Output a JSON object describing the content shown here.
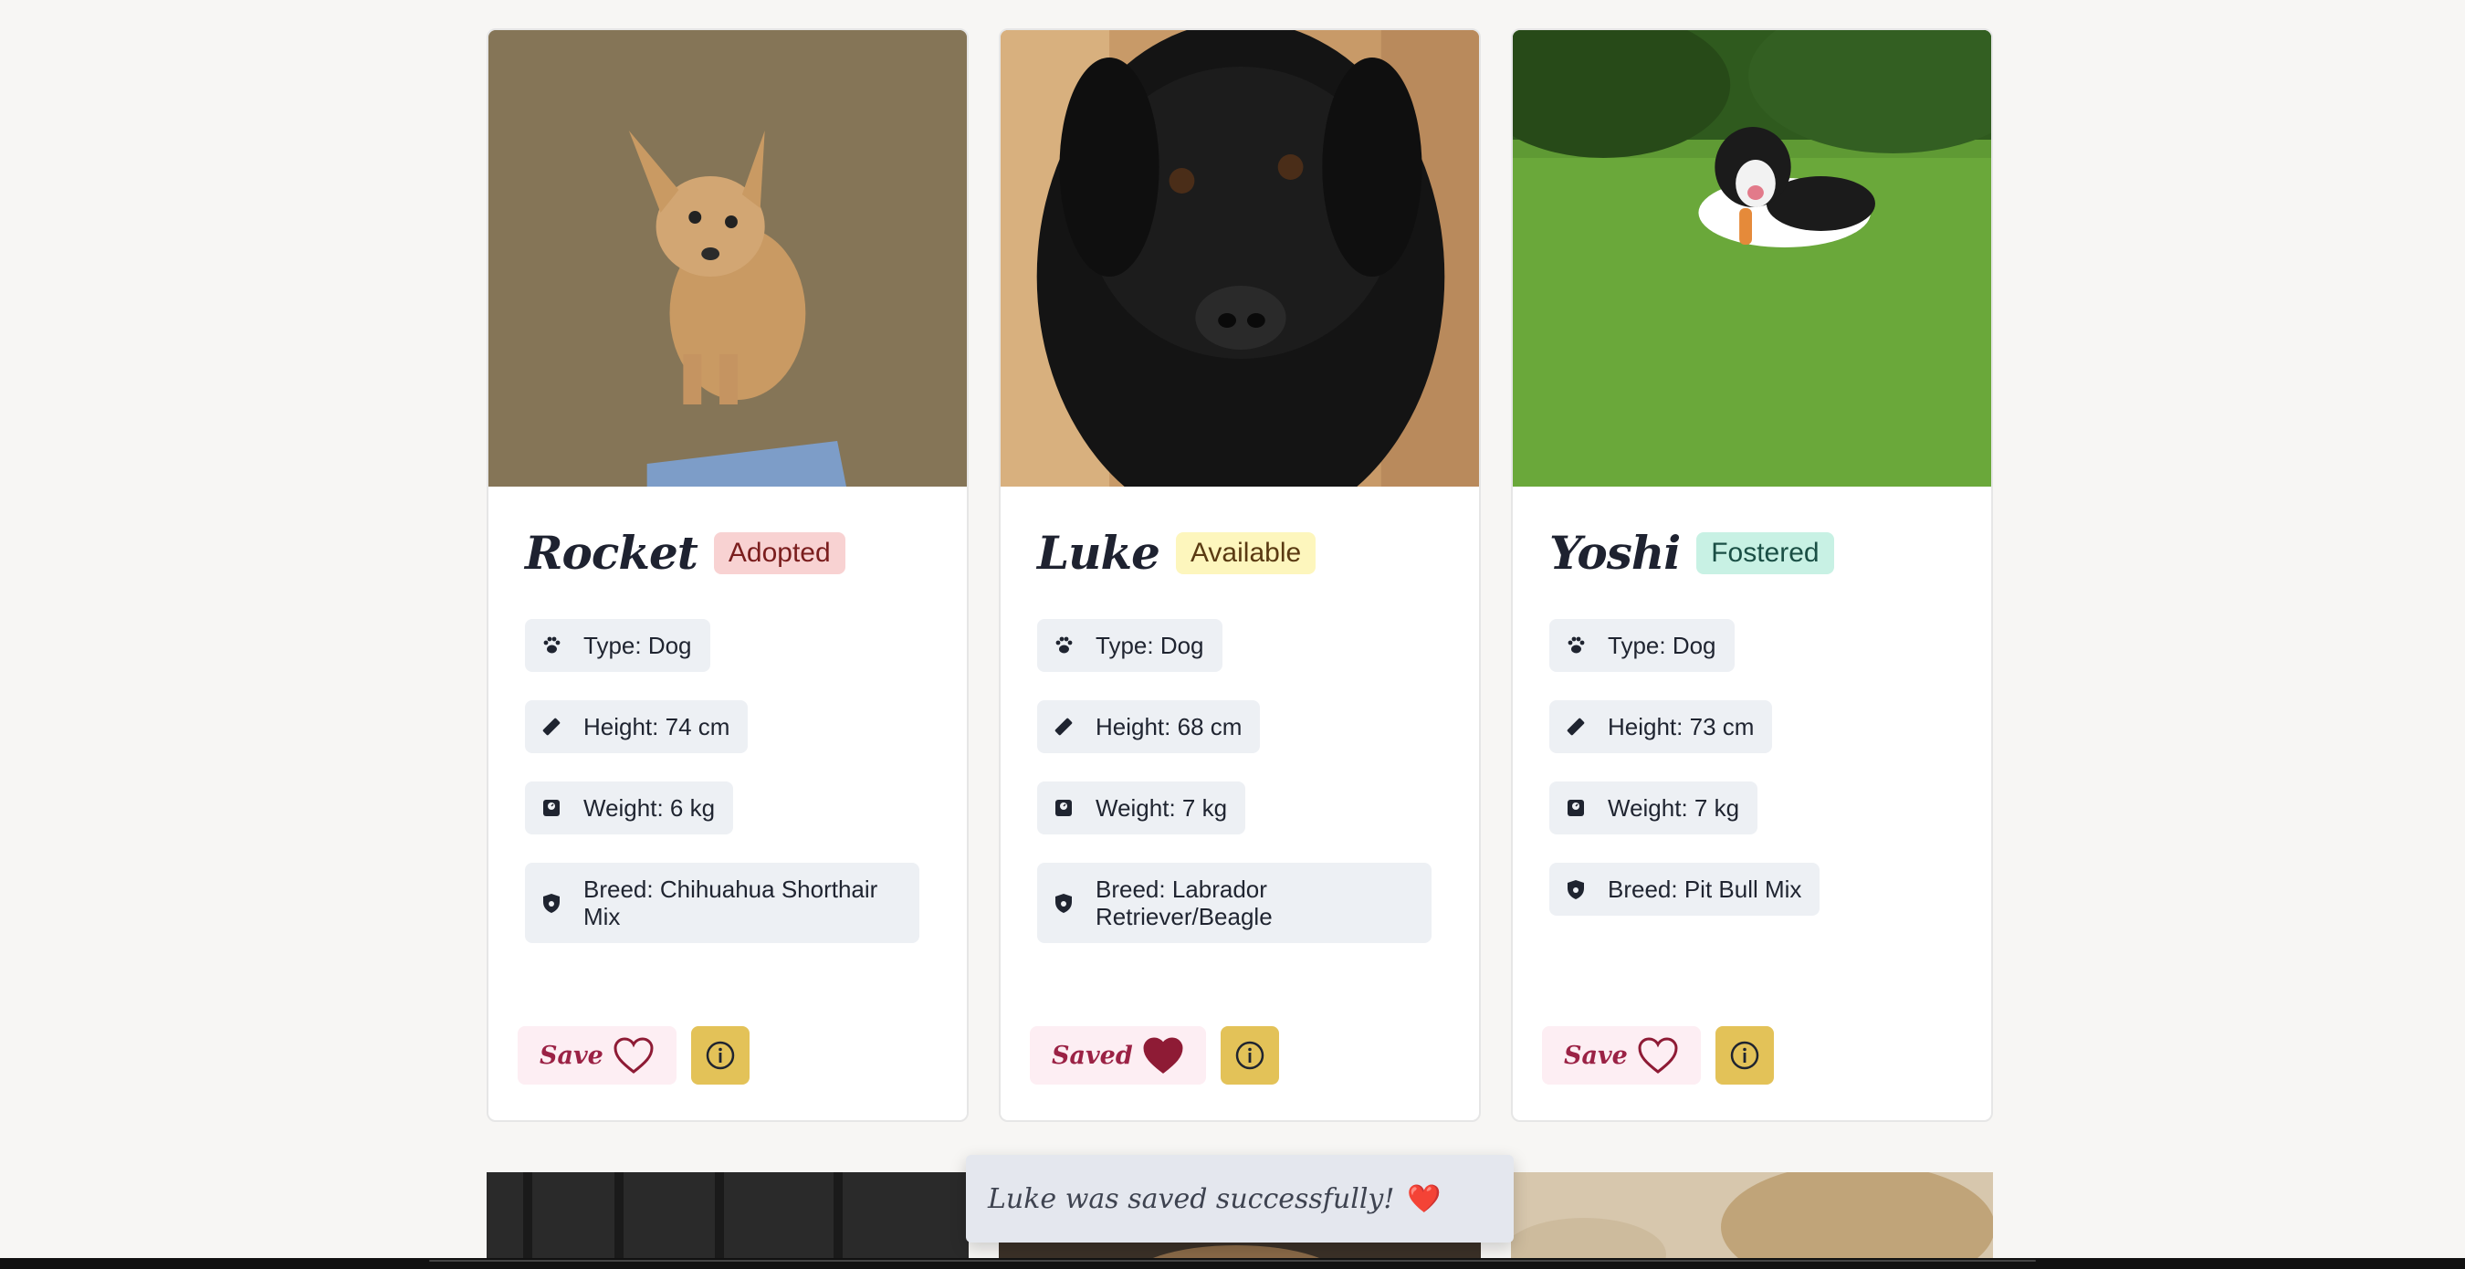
{
  "pets": [
    {
      "name": "Rocket",
      "status": "Adopted",
      "type": "Type: Dog",
      "height": "Height: 74 cm",
      "weight": "Weight: 6 kg",
      "breed": "Breed: Chihuahua Shorthair Mix",
      "save_label": "Save",
      "saved": false
    },
    {
      "name": "Luke",
      "status": "Available",
      "type": "Type: Dog",
      "height": "Height: 68 cm",
      "weight": "Weight: 7 kg",
      "breed": "Breed: Labrador Retriever/Beagle",
      "save_label": "Saved",
      "saved": true
    },
    {
      "name": "Yoshi",
      "status": "Fostered",
      "type": "Type: Dog",
      "height": "Height: 73 cm",
      "weight": "Weight: 7 kg",
      "breed": "Breed: Pit Bull Mix",
      "save_label": "Save",
      "saved": false
    }
  ],
  "toast": {
    "message": "Luke was saved successfully!",
    "emoji": "❤️"
  },
  "colors": {
    "adopted": "#f8d2d2",
    "available": "#fdf6bd",
    "fostered": "#c8f1e4",
    "heart": "#8e1b35",
    "info_button": "#e3c258"
  }
}
